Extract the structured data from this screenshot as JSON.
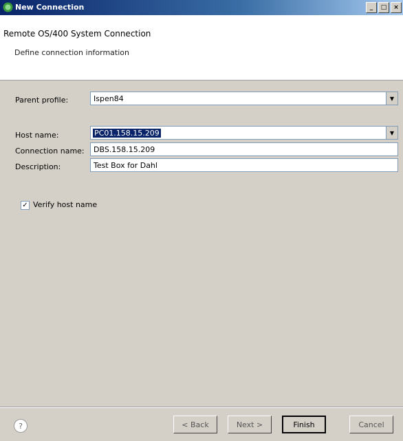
{
  "window": {
    "title": "New Connection"
  },
  "banner": {
    "title": "Remote OS/400 System Connection",
    "subtitle": "Define connection information"
  },
  "form": {
    "parent_profile": {
      "label": "Parent profile:",
      "value": "Ispen84"
    },
    "host_name": {
      "label": "Host name:",
      "value": "PC01.158.15.209"
    },
    "connection_name": {
      "label": "Connection name:",
      "value": "DBS.158.15.209"
    },
    "description": {
      "label": "Description:",
      "value": "Test Box for Dahl"
    },
    "verify": {
      "label": "Verify host name",
      "checked": true
    }
  },
  "buttons": {
    "back": "< Back",
    "next": "Next >",
    "finish": "Finish",
    "cancel": "Cancel"
  },
  "icons": {
    "help": "help-icon"
  }
}
